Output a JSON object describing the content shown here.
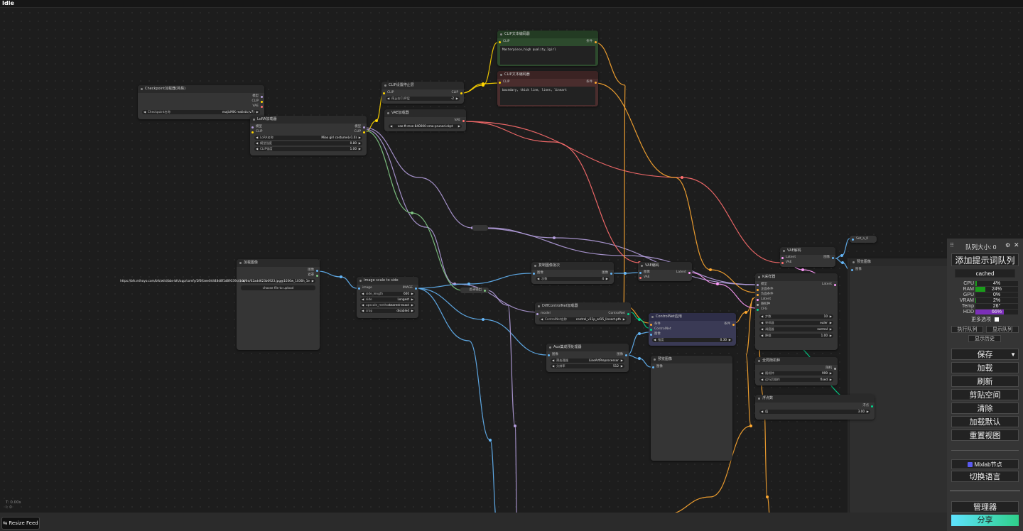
{
  "status": {
    "title": "Idle"
  },
  "colors": {
    "clip": "#ffd500",
    "model": "#b39ddb",
    "vae": "#ff6e6e",
    "image": "#64b5f6",
    "latent": "#ff9cf9",
    "cond": "#ffa931",
    "control": "#00d78d",
    "mask": "#81c784"
  },
  "nodes": {
    "checkpoint": {
      "title": "Checkpoint加载器(简易)",
      "out_model": "模型",
      "out_clip": "CLIP",
      "out_vae": "VAE",
      "w_label": "Checkpoint名称",
      "w_value": "majicMIX realistic(v7)"
    },
    "lora": {
      "title": "LoRA加载器",
      "in_model": "模型",
      "in_clip": "CLIP",
      "out_model": "模型",
      "out_clip": "CLIP",
      "w1_label": "LoRA名称",
      "w1_value": "Miao girl costume(v1.0)",
      "w2_label": "模型强度",
      "w2_value": "0.80",
      "w3_label": "CLIP强度",
      "w3_value": "1.00"
    },
    "clipstop": {
      "title": "CLIP设置停止层",
      "in_clip": "CLIP",
      "out_clip": "CLIP",
      "w_label": "停止在CLIP层",
      "w_value": "-2"
    },
    "vaeloader": {
      "title": "VAE加载器",
      "out_vae": "VAE",
      "w_label": "vae名称",
      "w_value": "vae-ft-mse-840000-ema-pruned.ckpt"
    },
    "pos": {
      "title": "CLIP文本编码器",
      "in_clip": "CLIP",
      "out": "条件",
      "text": "Masterpiece,high quality,1girl"
    },
    "neg": {
      "title": "CLIP文本编码器",
      "in_clip": "CLIP",
      "out": "条件",
      "text": "boundary, thick line, lines, lineart"
    },
    "loadimage": {
      "title": "加载图像",
      "out_image": "图像",
      "out_mask": "遮罩",
      "w_label": "图像",
      "w_value": "https://bfs.mihoyo.com/bfs/wiki/bbs-bfs/app/comfy/2f6f/aee04448d8f1d89339c4b0f/8d/02add623b0923.jpg@1036w_1036h_1e",
      "btn": "choose file to upload"
    },
    "imgscale": {
      "title": "Image scale to side",
      "in_image": "image",
      "out_image": "IMAGE",
      "w1_label": "side_length",
      "w1_value": "600",
      "w2_label": "side",
      "w2_value": "Longest",
      "w3_label": "upscale_method",
      "w3_value": "nearest-exact",
      "w4_label": "crop",
      "w4_value": "disabled"
    },
    "repeat": {
      "title": "复制图像批次",
      "in": "图像",
      "out": "图像",
      "w_label": "次数",
      "w_value": "4"
    },
    "vaeencode": {
      "title": "VAE编码",
      "in_img": "图像",
      "in_vae": "VAE",
      "out": "Latent"
    },
    "diffcn": {
      "title": "DiffControlNet加载器",
      "in_model": "model",
      "out": "ControlNet",
      "w_label": "ControlNet名称",
      "w_value": "control_v11p_sd15_lineart.pth"
    },
    "aux": {
      "title": "Aux集成预处理器",
      "in": "图像",
      "out": "图像",
      "w1_label": "预处理器",
      "w1_value": "LineArtPreprocessor",
      "w2_label": "分辨率",
      "w2_value": "512"
    },
    "cnapply": {
      "title": "ControlNet应用",
      "in1": "条件",
      "in2": "ControlNet",
      "in3": "图像",
      "out": "条件",
      "w_label": "强度",
      "w_value": "0.30"
    },
    "preview1": {
      "title": "预览图像",
      "in": "图像"
    },
    "ksampler": {
      "title": "K采样器",
      "in1": "模型",
      "in2": "正面条件",
      "in3": "负面条件",
      "in4": "Latent",
      "in5": "随机种",
      "in6": "CFG",
      "out": "Latent",
      "w1_label": "步数",
      "w1_value": "10",
      "w2_label": "采样器",
      "w2_value": "euler",
      "w3_label": "调度器",
      "w3_value": "normal",
      "w4_label": "降噪",
      "w4_value": "1.00"
    },
    "vaedecode": {
      "title": "VAE解码",
      "in1": "Latent",
      "in2": "VAE",
      "out": "图像"
    },
    "preview2": {
      "title": "预览图像",
      "in": "图像"
    },
    "setnode": {
      "title": "Set_a_0"
    },
    "seed": {
      "title": "全局随机种",
      "out": "随机",
      "w1_label": "随机种",
      "w1_value": "999",
      "w2_label": "运行后操作",
      "w2_value": "fixed"
    },
    "float": {
      "title": "浮点数",
      "out": "浮点",
      "w_label": "值",
      "w_value": "3.00"
    },
    "reroute_label": "遮罩输出"
  },
  "sidebar": {
    "queue_label": "队列大小: 0",
    "add_queue": "添加提示词队列",
    "cached": "cached",
    "stats": [
      {
        "k": "CPU",
        "v": "4%",
        "pct": 4,
        "color": "#1a9c1a"
      },
      {
        "k": "RAM",
        "v": "24%",
        "pct": 24,
        "color": "#1a9c1a"
      },
      {
        "k": "GPU",
        "v": "0%",
        "pct": 0,
        "color": "#1a9c1a"
      },
      {
        "k": "VRAM",
        "v": "2%",
        "pct": 2,
        "color": "#1a9c1a"
      },
      {
        "k": "Temp",
        "v": "26°",
        "pct": 26,
        "color": "#222222"
      },
      {
        "k": "HDD",
        "v": "66%",
        "pct": 66,
        "color": "#7b2fb8"
      }
    ],
    "more_options": "更多选项",
    "exec_queue": "执行队列",
    "show_queue": "显示队列",
    "show_history": "显示历史",
    "save": "保存",
    "load": "加载",
    "refresh": "刷新",
    "clipspace": "剪贴空间",
    "clear": "清除",
    "load_default": "加载默认",
    "reset_view": "重置视图",
    "mixlab": "Mixlab节点",
    "switch_lang": "切换语言",
    "manager": "管理器",
    "share": "分享"
  },
  "footer": {
    "resize_feed": "Resize Feed",
    "stat1": "T: 0.00s",
    "stat2": "I: 0"
  }
}
